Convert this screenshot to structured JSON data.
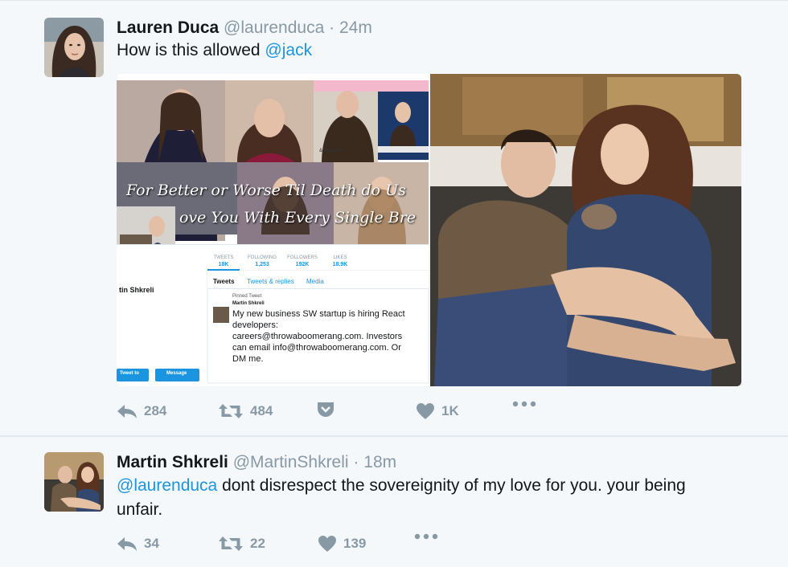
{
  "tweets": [
    {
      "name": "Lauren Duca",
      "handle": "@laurenduca",
      "separator": "·",
      "time": "24m",
      "text_before": "How is this allowed ",
      "mention": "@jack",
      "actions": {
        "replies": "284",
        "retweets": "484",
        "likes": "1K"
      },
      "media": {
        "collage_overlay_line1": "For Better or Worse Til Death do Us",
        "collage_overlay_line2": "ove You With Every Single Bre",
        "reporter_label": "& Reporter",
        "profile_name": "tin Shkreli",
        "stats": [
          {
            "label": "TWEETS",
            "value": "18K"
          },
          {
            "label": "FOLLOWING",
            "value": "1,253"
          },
          {
            "label": "FOLLOWERS",
            "value": "192K"
          },
          {
            "label": "LIKES",
            "value": "18.9K"
          }
        ],
        "tabs": [
          "Tweets",
          "Tweets & replies",
          "Media"
        ],
        "pinned_label": "Pinned Tweet",
        "pinned_author": "Martin Shkreli",
        "pinned_text_1": "My new business SW startup is hiring React",
        "pinned_text_2": "developers:",
        "pinned_text_3": "careers@throwaboomerang.com. Investors",
        "pinned_text_4": "can email info@throwaboomerang.com. Or",
        "pinned_text_5": "DM me.",
        "tweet_to_label": "Tweet to",
        "message_label": "Message"
      }
    },
    {
      "name": "Martin Shkreli",
      "handle": "@MartinShkreli",
      "separator": "·",
      "time": "18m",
      "mention": "@laurenduca",
      "text_after": " dont disrespect the sovereignity of my love for you. your being unfair.",
      "actions": {
        "replies": "34",
        "retweets": "22",
        "likes": "139"
      }
    }
  ],
  "colors": {
    "background": "#f5f8fa",
    "link": "#1b95e0",
    "muted": "#8899a6",
    "divider": "#e1e8ed"
  },
  "icons": [
    "reply-icon",
    "retweet-icon",
    "pocket-icon",
    "like-icon",
    "more-icon"
  ]
}
